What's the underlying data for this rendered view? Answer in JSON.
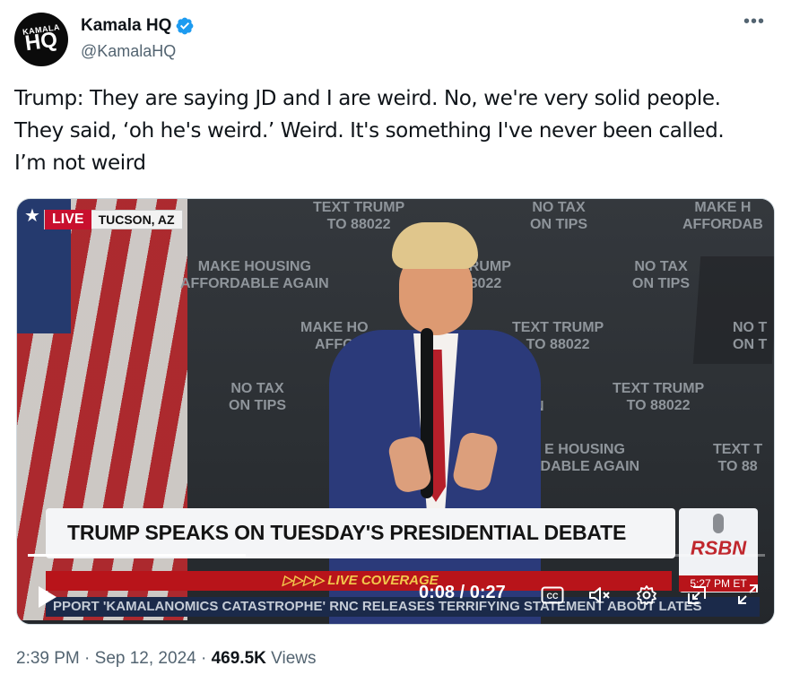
{
  "author": {
    "display_name": "Kamala HQ",
    "handle": "@KamalaHQ",
    "avatar_text_top": "KAMALA",
    "avatar_text_main": "HQ",
    "verified_color": "#1d9bf0"
  },
  "more_label": "•••",
  "tweet": {
    "lines": [
      "Trump: They are saying JD and I are weird. No, we're very solid people.",
      "They said, ‘oh he's weird.’ Weird. It's something I've never been called.",
      "I’m not weird"
    ]
  },
  "video": {
    "live_label": "LIVE",
    "location": "TUCSON, AZ",
    "headline": "TRUMP SPEAKS ON TUESDAY'S PRESIDENTIAL DEBATE",
    "live_coverage": "▷▷▷▷ LIVE COVERAGE",
    "ticker": "PPORT    'KAMALANOMICS CATASTROPHE' RNC RELEASES TERRIFYING STATEMENT ABOUT LATES",
    "network": "RSBN",
    "network_time": "5:27 PM ET",
    "current_time": "0:08",
    "duration": "0:27",
    "time_display": "0:08 / 0:27",
    "progress_fraction": 0.296,
    "backdrop": [
      {
        "text": "TEXT TRUMP\nTO 88022",
        "style": "top:0px;left:330px;"
      },
      {
        "text": "NO TAX\nON TIPS",
        "style": "top:0px;left:572px;"
      },
      {
        "text": "MAKE H\nAFFORDAB",
        "style": "top:0px;left:742px;"
      },
      {
        "text": "MAKE HOUSING\nAFFORDABLE AGAIN",
        "style": "top:66px;left:182px;"
      },
      {
        "text": "TRUMP\n8022",
        "style": "top:66px;left:494px;"
      },
      {
        "text": "NO TAX\nON TIPS",
        "style": "top:66px;left:686px;"
      },
      {
        "text": "MAKE HO\nAFFO",
        "style": "top:134px;left:316px;"
      },
      {
        "text": "TEXT TRUMP\nTO 88022",
        "style": "top:134px;left:552px;"
      },
      {
        "text": "NO T\nON T",
        "style": "top:134px;left:798px;"
      },
      {
        "text": "NO TAX\nON TIPS",
        "style": "top:202px;left:236px;"
      },
      {
        "text": "TEXT TRUMP\nTO 88022",
        "style": "top:202px;left:664px;"
      },
      {
        "text": "AIN",
        "style": "top:222px;left:560px;"
      },
      {
        "text": "E HOUSING\nRDABLE AGAIN",
        "style": "top:270px;left:572px;"
      },
      {
        "text": "TEXT T\nTO 88",
        "style": "top:270px;left:776px;"
      }
    ]
  }
}
